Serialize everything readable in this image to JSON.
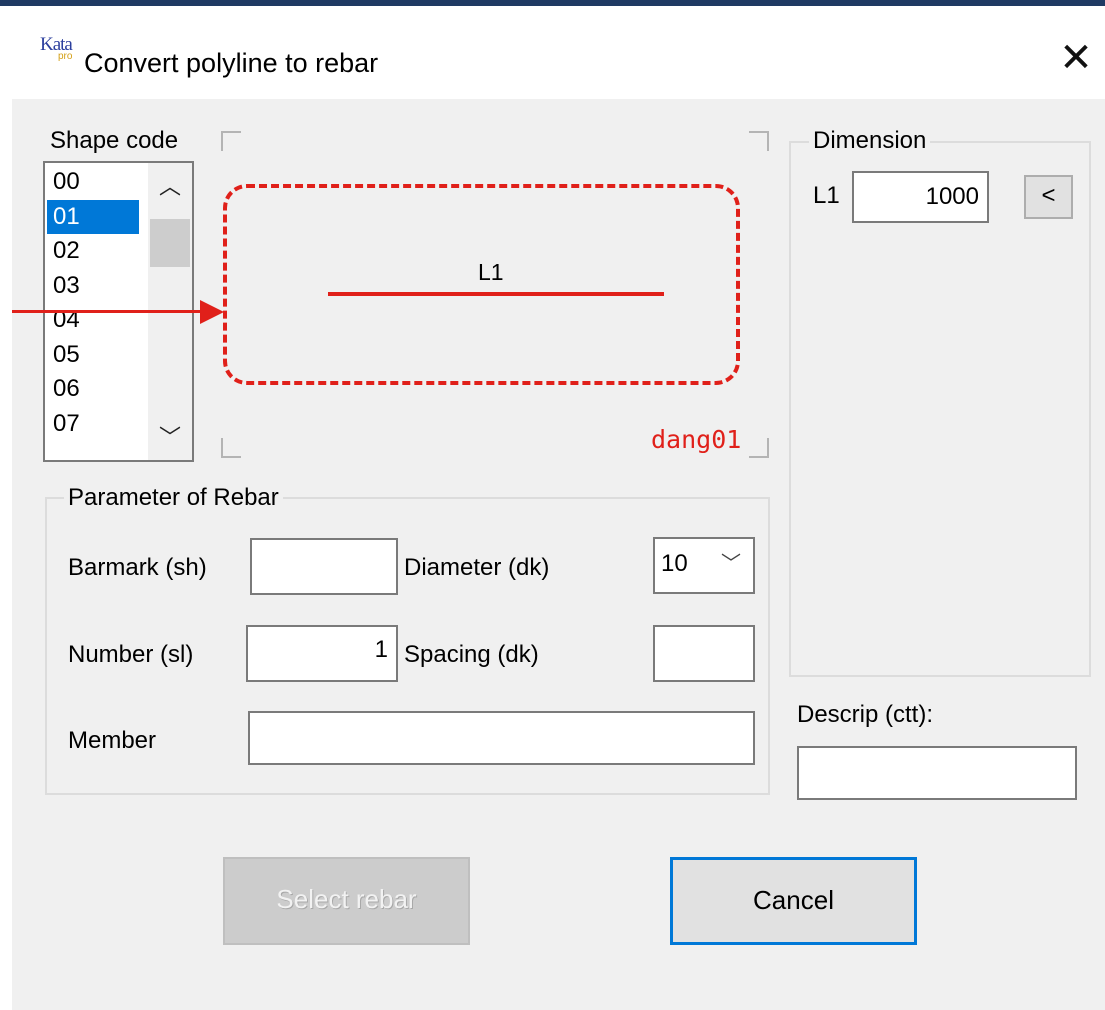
{
  "window": {
    "title": "Convert polyline to rebar",
    "logo_text": "Kata",
    "logo_subtext": "pro"
  },
  "shape_code": {
    "label": "Shape code",
    "items": [
      "00",
      "01",
      "02",
      "03",
      "04",
      "05",
      "06",
      "07"
    ],
    "selected": "01"
  },
  "preview": {
    "segment_label": "L1",
    "shape_name": "dang01"
  },
  "dimension": {
    "group_title": "Dimension",
    "l1_label": "L1",
    "l1_value": "1000",
    "pick_button": "<"
  },
  "rebar_params": {
    "group_title": "Parameter of Rebar",
    "barmark_label": "Barmark (sh)",
    "barmark_value": "",
    "diameter_label": "Diameter (dk)",
    "diameter_value": "10",
    "number_label": "Number (sl)",
    "number_value": "1",
    "spacing_label": "Spacing (dk)",
    "spacing_value": "",
    "member_label": "Member",
    "member_value": ""
  },
  "description": {
    "label": "Descrip (ctt):",
    "value": ""
  },
  "buttons": {
    "select_rebar": "Select rebar",
    "cancel": "Cancel"
  },
  "colors": {
    "accent": "#0078d7",
    "annotation_red": "#e0201a"
  }
}
